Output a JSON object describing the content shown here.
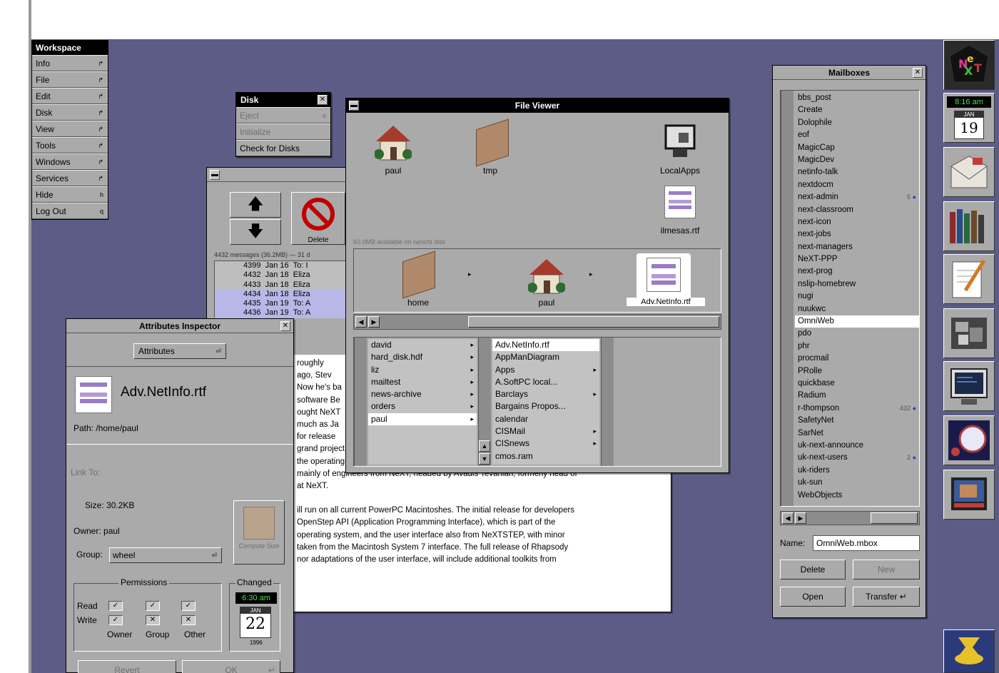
{
  "workspace_menu": {
    "title": "Workspace",
    "items": [
      {
        "label": "Info",
        "key": "↱"
      },
      {
        "label": "File",
        "key": "↱"
      },
      {
        "label": "Edit",
        "key": "↱"
      },
      {
        "label": "Disk",
        "key": "↱"
      },
      {
        "label": "View",
        "key": "↱"
      },
      {
        "label": "Tools",
        "key": "↱"
      },
      {
        "label": "Windows",
        "key": "↱"
      },
      {
        "label": "Services",
        "key": "↱"
      },
      {
        "label": "Hide",
        "key": "h"
      },
      {
        "label": "Log Out",
        "key": "q"
      }
    ]
  },
  "disk_menu": {
    "title": "Disk",
    "items": [
      {
        "label": "Eject",
        "key": "e"
      },
      {
        "label": "Initialize",
        "key": ""
      },
      {
        "label": "Check for Disks",
        "key": ""
      }
    ]
  },
  "file_viewer": {
    "title": "File Viewer",
    "shelf_icons": [
      "paul",
      "tmp",
      "LocalApps",
      "ilmesas.rtf"
    ],
    "status": "60.0MB available on nenchi disk",
    "path_icons": [
      "home",
      "paul",
      "Adv.NetInfo.rtf"
    ],
    "col1": [
      {
        "label": "david",
        "arrow": true
      },
      {
        "label": "hard_disk.hdf",
        "arrow": true
      },
      {
        "label": "liz",
        "arrow": true
      },
      {
        "label": "mailtest",
        "arrow": true
      },
      {
        "label": "news-archive",
        "arrow": true
      },
      {
        "label": "orders",
        "arrow": true
      },
      {
        "label": "paul",
        "arrow": true
      }
    ],
    "col2": [
      {
        "label": "Adv.NetInfo.rtf",
        "arrow": false
      },
      {
        "label": "AppManDiagram",
        "arrow": false
      },
      {
        "label": "Apps",
        "arrow": true
      },
      {
        "label": "A.SoftPC local...",
        "arrow": false
      },
      {
        "label": "Barclays",
        "arrow": true
      },
      {
        "label": "Bargains Propos...",
        "arrow": false
      },
      {
        "label": "calendar",
        "arrow": false
      },
      {
        "label": "CISMail",
        "arrow": true
      },
      {
        "label": "CISnews",
        "arrow": true
      },
      {
        "label": "cmos.ram",
        "arrow": false
      }
    ]
  },
  "mail_window": {
    "delete_label": "Delete",
    "info": "4432 messages (36.2MB) — 31 d",
    "rows": [
      {
        "num": "4399",
        "date": "Jan 16",
        "from": "To: I"
      },
      {
        "num": "4432",
        "date": "Jan 18",
        "from": "Eliza"
      },
      {
        "num": "4433",
        "date": "Jan 18",
        "from": "Eliza"
      },
      {
        "num": "4434",
        "date": "Jan 18",
        "from": "Eliza"
      },
      {
        "num": "4435",
        "date": "Jan 19",
        "from": "To: A"
      },
      {
        "num": "4436",
        "date": "Jan 19",
        "from": "To: A"
      }
    ],
    "body_lines": [
      "roughly",
      "ago, Stev",
      "Now he's ba",
      "software Be",
      "ought NeXT",
      "much as Ja",
      "for release",
      "grand project, codenamed \"Rhapsody\". Rhapsody will be based initially on",
      "the operating system acquired with NeXT, and with a development team",
      "mainly of engineers from NeXT, headed by Avadis Tevanian, formerly head of",
      "at NeXT.",
      "",
      "ill run on all current PowerPC Macintoshes. The initial release for developers",
      "OpenStep API (Application Programming Interface), which is part of the",
      "operating system, and the user interface also from NeXTSTEP, with minor",
      "taken from the Macintosh System 7 interface. The full release of Rhapsody",
      "nor adaptations of the user interface, will include additional toolkits from"
    ]
  },
  "inspector": {
    "title": "Attributes Inspector",
    "popup": "Attributes",
    "filename": "Adv.NetInfo.rtf",
    "path_label": "Path:",
    "path_value": "/home/paul",
    "link_to": "Link To:",
    "size_label": "Size:",
    "size_value": "30.2KB",
    "owner_label": "Owner:",
    "owner_value": "paul",
    "group_label": "Group:",
    "group_value": "wheel",
    "compute_label": "Compute Size",
    "permissions_label": "Permissions",
    "read_label": "Read",
    "write_label": "Write",
    "owner_col": "Owner",
    "group_col": "Group",
    "other_col": "Other",
    "changed_label": "Changed",
    "changed_time": "6:30 am",
    "changed_month": "JAN",
    "changed_day": "22",
    "changed_year": "1996",
    "revert_label": "Revert",
    "ok_label": "OK"
  },
  "mailboxes": {
    "title": "Mailboxes",
    "items": [
      {
        "label": "bbs_post",
        "badge": ""
      },
      {
        "label": "Create",
        "badge": ""
      },
      {
        "label": "Dolophile",
        "badge": ""
      },
      {
        "label": "eof",
        "badge": ""
      },
      {
        "label": "MagicCap",
        "badge": ""
      },
      {
        "label": "MagicDev",
        "badge": ""
      },
      {
        "label": "netinfo-talk",
        "badge": ""
      },
      {
        "label": "nextdocm",
        "badge": ""
      },
      {
        "label": "next-admin",
        "badge": "5"
      },
      {
        "label": "next-classroom",
        "badge": ""
      },
      {
        "label": "next-icon",
        "badge": ""
      },
      {
        "label": "next-jobs",
        "badge": ""
      },
      {
        "label": "next-managers",
        "badge": ""
      },
      {
        "label": "NeXT-PPP",
        "badge": ""
      },
      {
        "label": "next-prog",
        "badge": ""
      },
      {
        "label": "nslip-homebrew",
        "badge": ""
      },
      {
        "label": "nugi",
        "badge": ""
      },
      {
        "label": "nuukwc",
        "badge": ""
      },
      {
        "label": "OmniWeb",
        "badge": ""
      },
      {
        "label": "pdo",
        "badge": ""
      },
      {
        "label": "phr",
        "badge": ""
      },
      {
        "label": "procmail",
        "badge": ""
      },
      {
        "label": "PRolle",
        "badge": ""
      },
      {
        "label": "quickbase",
        "badge": ""
      },
      {
        "label": "Radium",
        "badge": ""
      },
      {
        "label": "r-thompson",
        "badge": "432"
      },
      {
        "label": "SafetyNet",
        "badge": ""
      },
      {
        "label": "SarNet",
        "badge": ""
      },
      {
        "label": "uk-next-announce",
        "badge": ""
      },
      {
        "label": "uk-next-users",
        "badge": "2"
      },
      {
        "label": "uk-riders",
        "badge": ""
      },
      {
        "label": "uk-sun",
        "badge": ""
      },
      {
        "label": "WebObjects",
        "badge": ""
      }
    ],
    "selected": "OmniWeb",
    "name_label": "Name:",
    "name_value": "OmniWeb.mbox",
    "delete_label": "Delete",
    "new_label": "New",
    "open_label": "Open",
    "transfer_label": "Transfer"
  },
  "dock": {
    "clock_time": "8:16 am",
    "clock_month": "JAN",
    "clock_day": "19",
    "icons": [
      "next-logo-icon",
      "clock-icon",
      "mail-icon",
      "library-icon",
      "edit-icon",
      "workspace-icon",
      "terminal-icon",
      "omniweb-icon",
      "video-icon",
      "genie-icon"
    ]
  },
  "colors": {
    "desktop": "#5c5c86",
    "panel": "#aaaaaa",
    "title_active": "#000000",
    "title_inactive": "#aaaaaa"
  }
}
